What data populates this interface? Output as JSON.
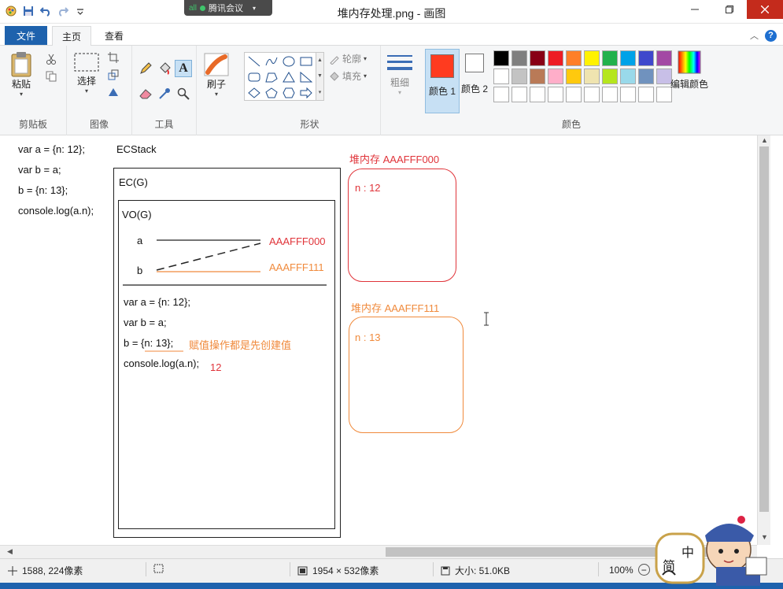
{
  "window": {
    "title": "堆内存处理.png - 画图",
    "meeting_label": "腾讯会议",
    "meeting_signal": "all"
  },
  "tabs": {
    "file": "文件",
    "home": "主页",
    "view": "查看"
  },
  "ribbon": {
    "clipboard": {
      "paste": "粘贴",
      "group": "剪贴板"
    },
    "image": {
      "select": "选择",
      "group": "图像"
    },
    "tools": {
      "group": "工具"
    },
    "brush": {
      "label": "刷子"
    },
    "shapes": {
      "outline": "轮廓",
      "fill": "填充",
      "group": "形状"
    },
    "size": {
      "label": "粗细"
    },
    "colors": {
      "color1_label": "颜色 1",
      "color2_label": "颜色 2",
      "edit_label": "编辑颜色",
      "group": "颜色",
      "color1": "#ff3b1f",
      "color2": "#ffffff",
      "palette": [
        "#000000",
        "#7f7f7f",
        "#880015",
        "#ed1c24",
        "#ff7f27",
        "#fff200",
        "#22b14c",
        "#00a2e8",
        "#3f48cc",
        "#a349a4",
        "#ffffff",
        "#c3c3c3",
        "#b97a57",
        "#ffaec9",
        "#ffc90e",
        "#efe4b0",
        "#b5e61d",
        "#99d9ea",
        "#7092be",
        "#c8bfe7",
        "#ffffff",
        "#ffffff",
        "#ffffff",
        "#ffffff",
        "#ffffff",
        "#ffffff",
        "#ffffff",
        "#ffffff",
        "#ffffff",
        "#ffffff"
      ]
    }
  },
  "canvas": {
    "left_code": [
      "var a = {n: 12};",
      "var b = a;",
      "b = {n: 13};",
      "console.log(a.n);"
    ],
    "ecstack_label": "ECStack",
    "ec_label": "EC(G)",
    "vo_label": "VO(G)",
    "var_a": "a",
    "var_b": "b",
    "addr_a": "AAAFFF000",
    "addr_b": "AAAFFF111",
    "inner_code": [
      "var a = {n: 12};",
      "var b = a;",
      "b = {n: 13};",
      "console.log(a.n);"
    ],
    "note": "赋值操作都是先创建值",
    "output": "12",
    "heap1_title": "堆内存 AAAFFF000",
    "heap1_content": "n : 12",
    "heap2_title": "堆内存 AAAFFF111",
    "heap2_content": "n : 13"
  },
  "status": {
    "cursor_pos": "1588, 224像素",
    "image_size": "1954 × 532像素",
    "file_size": "大小: 51.0KB",
    "zoom": "100%"
  },
  "ime": {
    "char1": "中",
    "char2": "简"
  }
}
